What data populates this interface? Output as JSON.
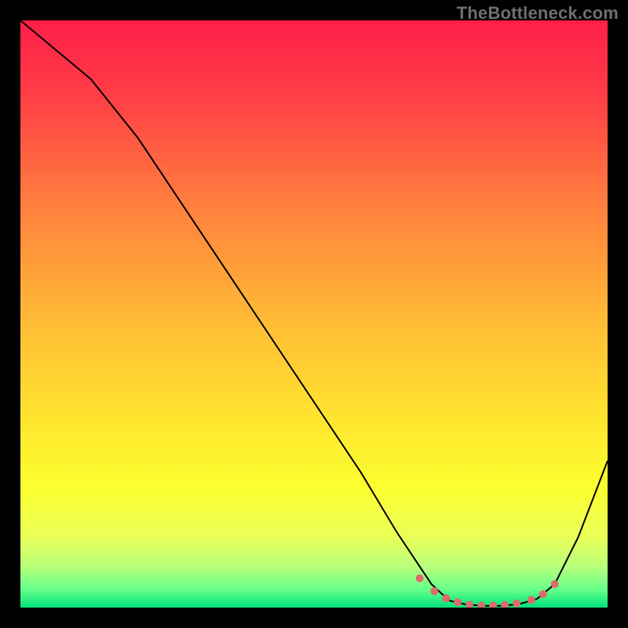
{
  "attribution": "TheBottleneck.com",
  "chart_data": {
    "type": "line",
    "title": "",
    "xlabel": "",
    "ylabel": "",
    "xlim": [
      0,
      100
    ],
    "ylim": [
      0,
      100
    ],
    "legend": false,
    "grid": false,
    "background": {
      "type": "vertical-gradient",
      "stops": [
        {
          "offset": 0.0,
          "color": "#ff1f48"
        },
        {
          "offset": 0.12,
          "color": "#ff3b46"
        },
        {
          "offset": 0.3,
          "color": "#ff7a3e"
        },
        {
          "offset": 0.5,
          "color": "#ffb836"
        },
        {
          "offset": 0.68,
          "color": "#ffe52e"
        },
        {
          "offset": 0.8,
          "color": "#fbff2f"
        },
        {
          "offset": 0.88,
          "color": "#e9ff58"
        },
        {
          "offset": 0.93,
          "color": "#b8ff7a"
        },
        {
          "offset": 0.97,
          "color": "#64ff8a"
        },
        {
          "offset": 1.0,
          "color": "#00e27a"
        }
      ]
    },
    "series": [
      {
        "name": "bottleneck-curve",
        "color": "#000000",
        "stroke_width": 2,
        "x": [
          0,
          6,
          12,
          20,
          30,
          40,
          50,
          58,
          64,
          68,
          70,
          73,
          76,
          79,
          82,
          85,
          88,
          91,
          95,
          100
        ],
        "y": [
          100,
          95,
          90,
          80,
          65,
          50,
          35,
          23,
          13,
          7,
          4,
          1.2,
          0.5,
          0.3,
          0.3,
          0.6,
          1.5,
          4,
          12,
          25
        ]
      }
    ],
    "markers": {
      "name": "sweet-spot",
      "color": "#dd6b6b",
      "radius": 5,
      "x": [
        68,
        70.5,
        72.5,
        74.5,
        76.5,
        78.5,
        80.5,
        82.5,
        84.5,
        87,
        89,
        91
      ],
      "y": [
        5.0,
        2.8,
        1.6,
        0.9,
        0.5,
        0.35,
        0.35,
        0.45,
        0.7,
        1.3,
        2.3,
        4.0
      ]
    }
  }
}
